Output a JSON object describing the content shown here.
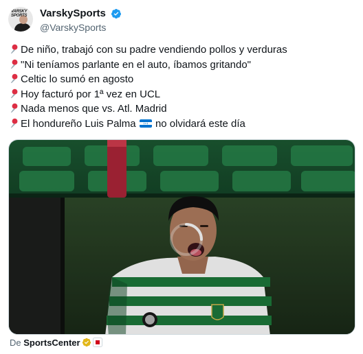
{
  "author": {
    "display_name": "VarskySports",
    "handle": "@VarskySports",
    "avatar_logo_text": "VARSKY SPORTS",
    "verified_color": "#1d9bf0"
  },
  "tweet": {
    "lines": [
      {
        "icon": "pushpin-icon",
        "text": "De niño, trabajó con su padre vendiendo pollos y verduras"
      },
      {
        "icon": "pushpin-icon",
        "text": "\"Ni teníamos parlante en el auto, íbamos gritando\""
      },
      {
        "icon": "pushpin-icon",
        "text": "Celtic lo sumó en agosto"
      },
      {
        "icon": "pushpin-icon",
        "text": "Hoy facturó por 1ª vez en UCL"
      },
      {
        "icon": "pushpin-icon",
        "text": "Nada menos que vs. Atl. Madrid"
      },
      {
        "icon": "pushpin-icon",
        "text_before_flag": "El hondureño Luis Palma",
        "flag": "honduras-flag-icon",
        "text_after_flag": "no olvidará este día"
      }
    ]
  },
  "media": {
    "description_icon": "video-loading-spinner-icon",
    "colors": {
      "stadium": "#0d3b22",
      "wall": "#2f4a2a",
      "jersey_green": "#1d7a3c"
    }
  },
  "attribution": {
    "prefix": "De",
    "source": "SportsCenter",
    "gold_badge": "gold-verified-icon",
    "red_badge": "espn-badge-icon"
  }
}
